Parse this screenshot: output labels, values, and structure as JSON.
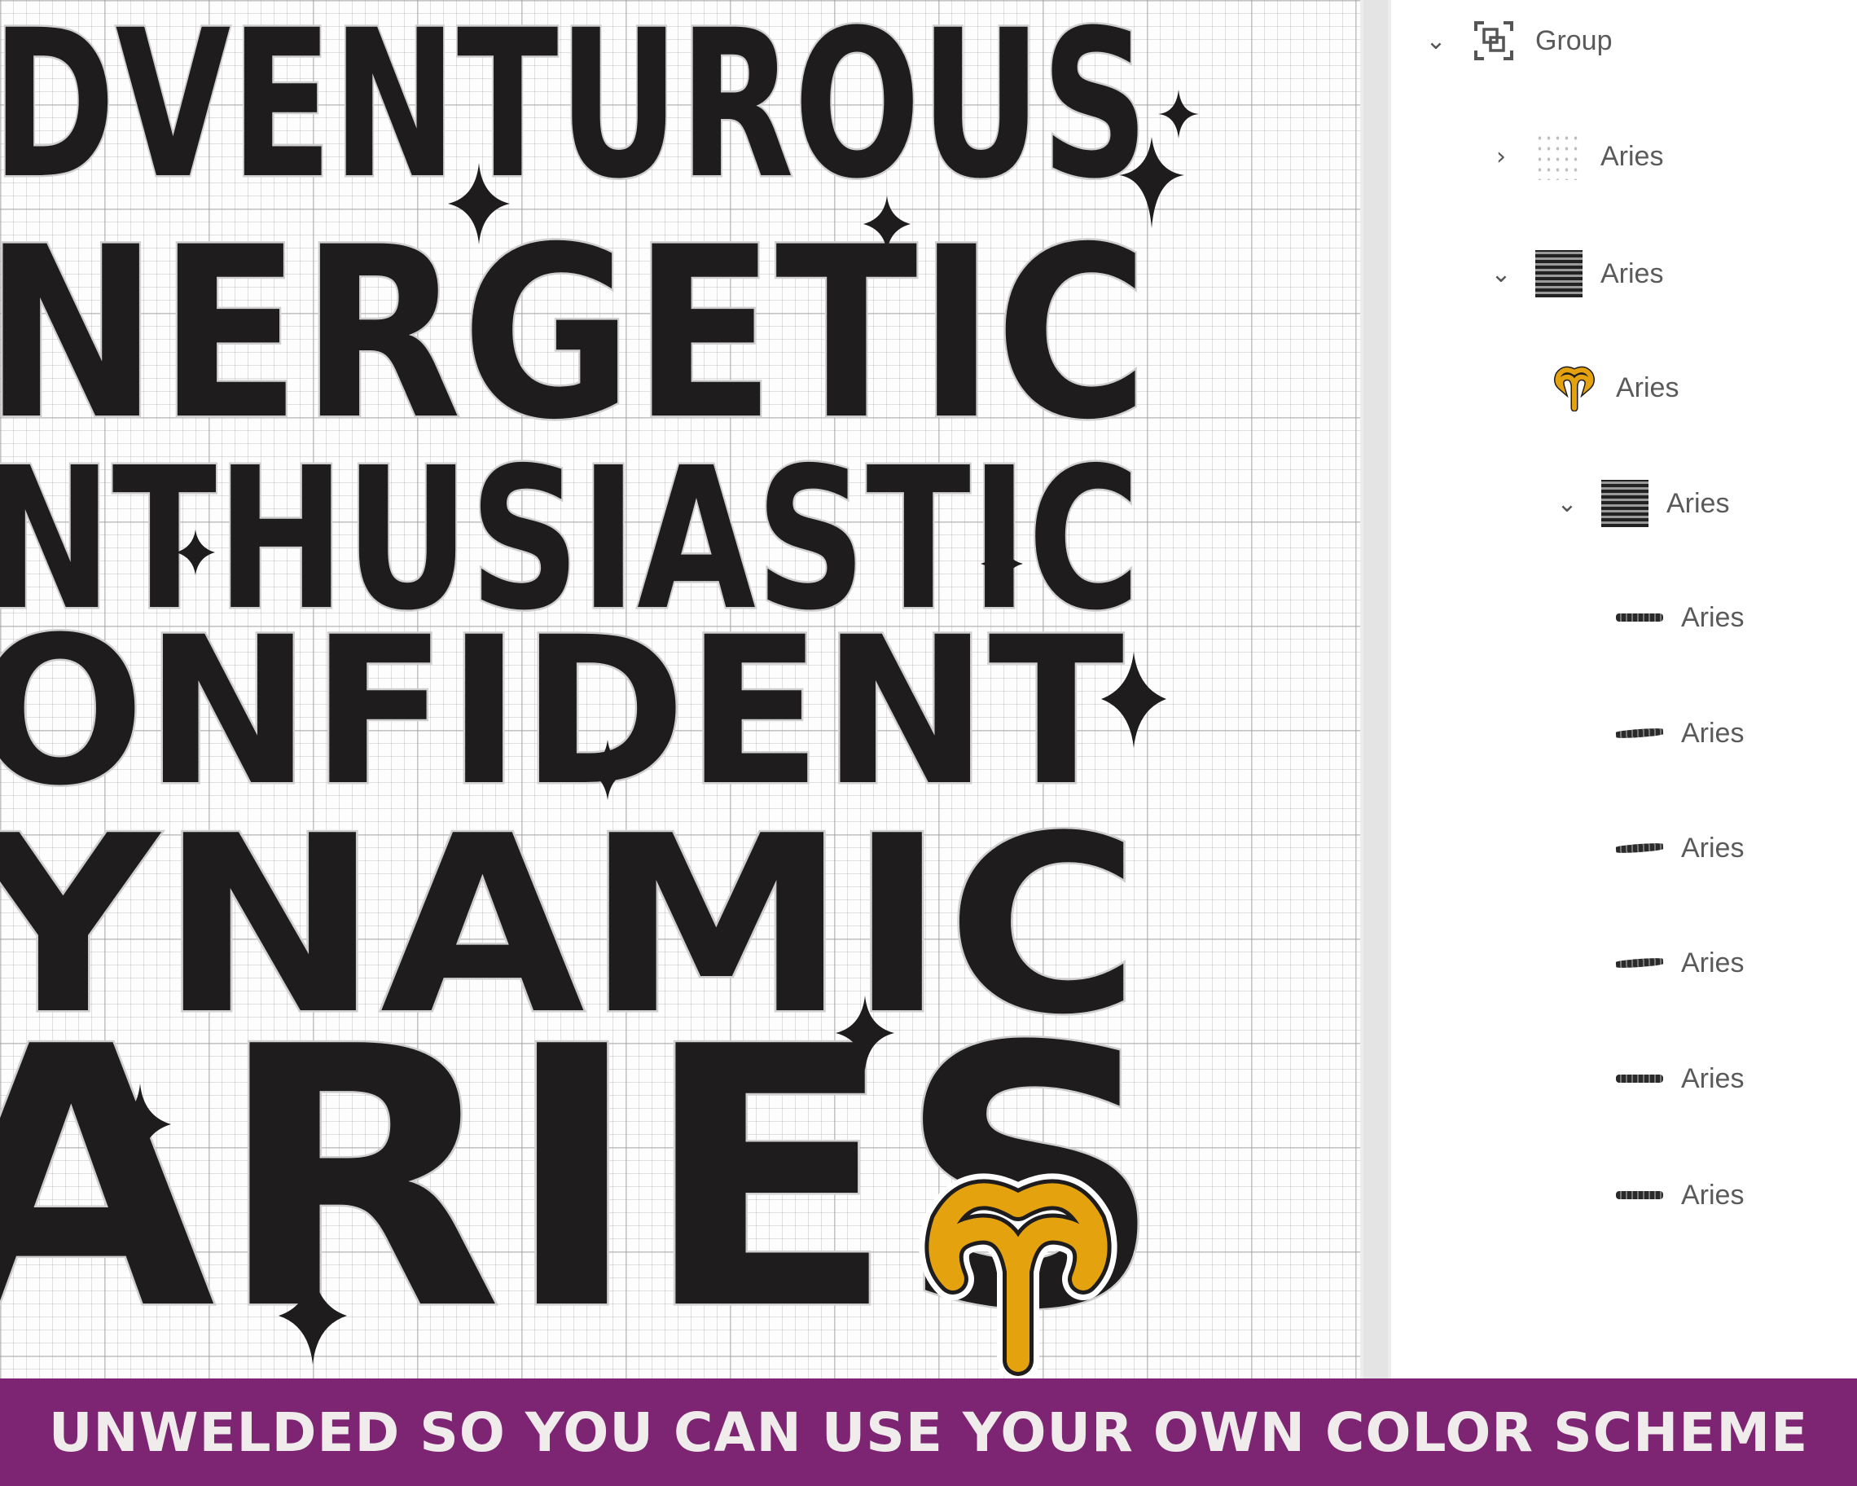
{
  "canvas": {
    "words": [
      "DVENTUROUS",
      "NERGETIC",
      "NTHUSIASTIC",
      "ONFIDENT",
      "YNAMIC",
      "ARIES"
    ],
    "accent_color": "#e3a20e",
    "text_color": "#1e1c1d"
  },
  "layers": {
    "items": [
      {
        "label": "Group",
        "icon": "group-icon",
        "chevron": "expanded"
      },
      {
        "label": "Aries",
        "icon": "scatter-thumbnail",
        "chevron": "collapsed"
      },
      {
        "label": "Aries",
        "icon": "design-thumbnail",
        "chevron": "expanded"
      },
      {
        "label": "Aries",
        "icon": "aries-symbol-thumbnail"
      },
      {
        "label": "Aries",
        "icon": "design-thumbnail",
        "chevron": "expanded"
      },
      {
        "label": "Aries",
        "icon": "aries-word-thumbnail"
      },
      {
        "label": "Aries",
        "icon": "dynamic-word-thumbnail"
      },
      {
        "label": "Aries",
        "icon": "confident-word-thumbnail"
      },
      {
        "label": "Aries",
        "icon": "enthusiastic-word-thumbnail"
      },
      {
        "label": "Aries",
        "icon": "energetic-word-thumbnail"
      },
      {
        "label": "Aries",
        "icon": "adventurous-word-thumbnail"
      }
    ]
  },
  "banner": {
    "text": "UNWELDED SO YOU CAN USE YOUR OWN COLOR SCHEME",
    "background": "#7d2572"
  }
}
